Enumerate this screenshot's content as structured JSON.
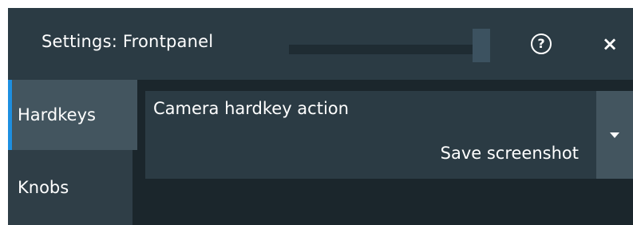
{
  "dialog": {
    "title": "Settings: Frontpanel",
    "help_icon": "help-circle-icon",
    "help_glyph": "?",
    "close_icon": "close-icon",
    "close_glyph": "×"
  },
  "sidebar": {
    "items": [
      {
        "label": "Hardkeys",
        "active": true
      },
      {
        "label": "Knobs",
        "active": false
      }
    ]
  },
  "setting": {
    "label": "Camera hardkey action",
    "value": "Save screenshot",
    "dropdown_icon": "caret-down-icon"
  },
  "colors": {
    "accent": "#1d8fe0",
    "titlebar": "#2b3b44",
    "background": "#1b262c"
  }
}
